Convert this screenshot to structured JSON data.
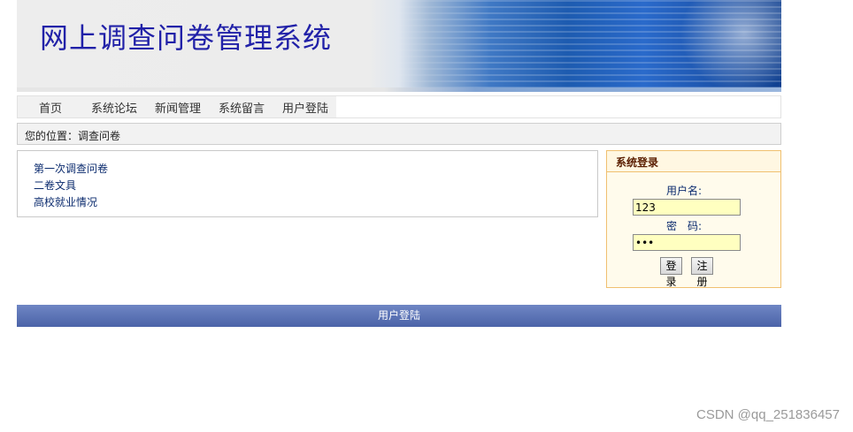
{
  "header": {
    "title": "网上调查问卷管理系统"
  },
  "nav": {
    "items": [
      {
        "label": "首页"
      },
      {
        "label": "系统论坛"
      },
      {
        "label": "新闻管理"
      },
      {
        "label": "系统留言"
      },
      {
        "label": "用户登陆"
      }
    ]
  },
  "breadcrumb": {
    "text": "您的位置：调查问卷"
  },
  "surveys": [
    {
      "label": "第一次调查问卷"
    },
    {
      "label": "二卷文具"
    },
    {
      "label": "高校就业情况"
    }
  ],
  "login": {
    "title": "系统登录",
    "username_label": "用户名:",
    "username_value": "123",
    "password_label": "密　码:",
    "password_value": "123",
    "login_button": "登录",
    "register_button": "注册"
  },
  "footer": {
    "label": "用户登陆"
  },
  "watermark": {
    "text": "CSDN @qq_251836457"
  },
  "colors": {
    "title": "#2121a8",
    "link": "#0b2b6e",
    "footer_bar": "#5a71b5",
    "login_border": "#f0c070",
    "input_bg": "#ffffc0"
  }
}
